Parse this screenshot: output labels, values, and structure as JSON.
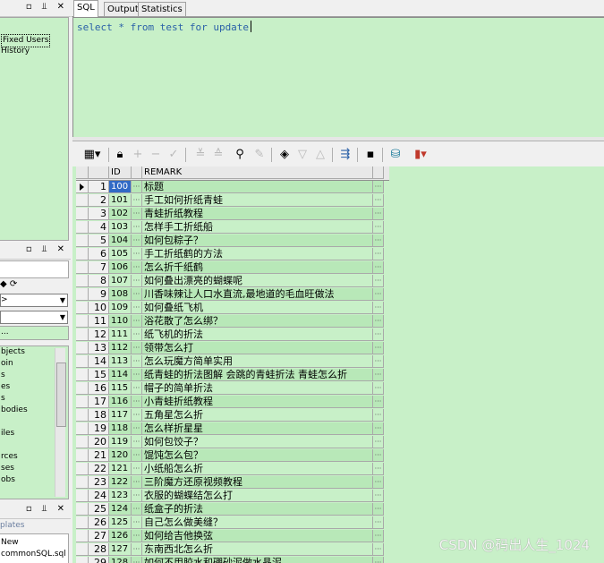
{
  "left_dock": {
    "top_panel": {
      "items": [
        "Fixed Users",
        "History"
      ]
    },
    "objects_panel": {
      "combo1": ">",
      "combo2": "",
      "filter": "...",
      "items": [
        "bjects",
        "oin",
        "s",
        "es",
        "s",
        "bodies",
        "",
        "iles",
        "",
        "rces",
        "ses",
        "obs"
      ]
    },
    "templates_tab": "plates",
    "new_item": "New",
    "file_item": "commonSQL.sql"
  },
  "tabs": [
    "SQL",
    "Output",
    "Statistics"
  ],
  "editor": {
    "sql": "select * from test for update"
  },
  "toolbar": {
    "icons": [
      "grid-options-icon",
      "lock-icon",
      "add-record-icon",
      "delete-record-icon",
      "post-record-icon",
      "filter-icon",
      "filter-clear-icon",
      "find-icon",
      "clear-icon",
      "query-by-example-icon",
      "next-page-icon",
      "previous-page-icon",
      "export-icon",
      "save-icon",
      "database-icon",
      "chart-icon"
    ]
  },
  "grid": {
    "columns": [
      "ID",
      "REMARK"
    ],
    "current_row": 0,
    "rows": [
      {
        "n": "1",
        "id": "100",
        "remark": "标题"
      },
      {
        "n": "2",
        "id": "101",
        "remark": "手工如何折纸青蛙"
      },
      {
        "n": "3",
        "id": "102",
        "remark": "青蛙折纸教程"
      },
      {
        "n": "4",
        "id": "103",
        "remark": "怎样手工折纸船"
      },
      {
        "n": "5",
        "id": "104",
        "remark": "如何包粽子？"
      },
      {
        "n": "6",
        "id": "105",
        "remark": "手工折纸鹤的方法"
      },
      {
        "n": "7",
        "id": "106",
        "remark": "怎么折千纸鹤"
      },
      {
        "n": "8",
        "id": "107",
        "remark": "如何叠出漂亮的蝴蝶呢"
      },
      {
        "n": "9",
        "id": "108",
        "remark": "川香味辣让人口水直流,最地道的毛血旺做法"
      },
      {
        "n": "10",
        "id": "109",
        "remark": "如何叠纸飞机"
      },
      {
        "n": "11",
        "id": "110",
        "remark": "浴花散了怎么绑？"
      },
      {
        "n": "12",
        "id": "111",
        "remark": "纸飞机的折法"
      },
      {
        "n": "13",
        "id": "112",
        "remark": "领带怎么打"
      },
      {
        "n": "14",
        "id": "113",
        "remark": "怎么玩魔方简单实用"
      },
      {
        "n": "15",
        "id": "114",
        "remark": "纸青蛙的折法图解 会跳的青蛙折法 青蛙怎么折"
      },
      {
        "n": "16",
        "id": "115",
        "remark": "帽子的简单折法"
      },
      {
        "n": "17",
        "id": "116",
        "remark": "小青蛙折纸教程"
      },
      {
        "n": "18",
        "id": "117",
        "remark": "五角星怎么折"
      },
      {
        "n": "19",
        "id": "118",
        "remark": "怎么样折星星"
      },
      {
        "n": "20",
        "id": "119",
        "remark": "如何包饺子？"
      },
      {
        "n": "21",
        "id": "120",
        "remark": "馄饨怎么包？"
      },
      {
        "n": "22",
        "id": "121",
        "remark": "小纸船怎么折"
      },
      {
        "n": "23",
        "id": "122",
        "remark": "三阶魔方还原视频教程"
      },
      {
        "n": "24",
        "id": "123",
        "remark": "衣服的蝴蝶结怎么打"
      },
      {
        "n": "25",
        "id": "124",
        "remark": "纸盒子的折法"
      },
      {
        "n": "26",
        "id": "125",
        "remark": "自己怎么做美缝？"
      },
      {
        "n": "27",
        "id": "126",
        "remark": "如何给吉他换弦"
      },
      {
        "n": "28",
        "id": "127",
        "remark": "东南西北怎么折"
      },
      {
        "n": "29",
        "id": "128",
        "remark": "如何不用胶水和硼砂泥做水晶泥"
      }
    ]
  },
  "watermark": "CSDN @码出人生_1024",
  "colors": {
    "grid_bg": "#c8f0c8",
    "sql_keyword": "#2b61a8",
    "selection": "#316ac5"
  }
}
